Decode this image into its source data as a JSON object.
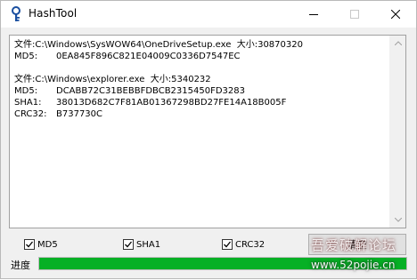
{
  "window": {
    "title": "HashTool"
  },
  "output": {
    "lines": [
      {
        "label": "文件:",
        "value": "C:\\Windows\\SysWOW64\\OneDriveSetup.exe  大小:30870320"
      },
      {
        "label": "MD5:",
        "value": "0EA845F896C821E04009C0336D7547EC"
      },
      {
        "label": "",
        "value": ""
      },
      {
        "label": "文件:",
        "value": "C:\\Windows\\explorer.exe  大小:5340232"
      },
      {
        "label": "MD5:",
        "value": "DCABB72C31BEBBFDBCB2315450FD3283"
      },
      {
        "label": "SHA1:",
        "value": "38013D682C7F81AB01367298BD27FE14A18B005F"
      },
      {
        "label": "CRC32:",
        "value": "B737730C"
      }
    ]
  },
  "options": {
    "md5_label": "MD5",
    "sha1_label": "SHA1",
    "crc32_label": "CRC32",
    "md5_checked": true,
    "sha1_checked": true,
    "crc32_checked": true
  },
  "actions": {
    "calculate_label": "清空"
  },
  "progress": {
    "label": "进度",
    "percent": 100,
    "color": "#06b025"
  },
  "watermark": {
    "line1": "吾爱破解论坛",
    "line2": "www.52pojie.cn"
  },
  "icons": {
    "app": "lock-key-icon",
    "minimize": "minimize-icon",
    "maximize": "maximize-icon",
    "close": "close-icon"
  }
}
